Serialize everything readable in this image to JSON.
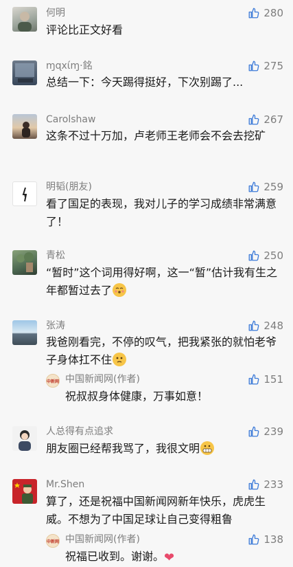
{
  "comments": [
    {
      "name": "何明",
      "likes": "280",
      "text": "评论比正文好看"
    },
    {
      "name": "ɱɋxίɱ·銘",
      "likes": "275",
      "text": "总结一下：今天踢得挺好，下次别踢了..."
    },
    {
      "name": "Carolshaw",
      "likes": "267",
      "text": "这条不过十万加，卢老师王老师会不会去挖矿"
    },
    {
      "name": "明韬(朋友)",
      "likes": "259",
      "text": "看了国足的表现，我对儿子的学习成绩非常满意了！"
    },
    {
      "name": "青松",
      "likes": "250",
      "text": "“暂时”这个词用得好啊，这一“暂”估计我有生之年都暂过去了"
    },
    {
      "name": "张涛",
      "likes": "248",
      "text": "我爸刚看完，不停的叹气，把我紧张的就怕老爷子身体扛不住"
    },
    {
      "name": "人总得有点追求",
      "likes": "239",
      "text": "朋友圈已经帮我骂了，我很文明"
    },
    {
      "name": "Mr.Shen",
      "likes": "233",
      "text": "算了，还是祝福中国新闻网新年快乐，虎虎生威。不想为了中国足球让自己变得粗鲁"
    }
  ],
  "replies": [
    {
      "name": "中国新闻网(作者)",
      "likes": "151",
      "text": "祝叔叔身体健康，万事如意！",
      "badge": "中新网"
    },
    {
      "name": "中国新闻网(作者)",
      "likes": "138",
      "text": "祝福已收到。谢谢。",
      "badge": "中新网"
    }
  ],
  "icons": {
    "like": "thumbs-up-icon",
    "heart": "heart-emoji-icon"
  }
}
